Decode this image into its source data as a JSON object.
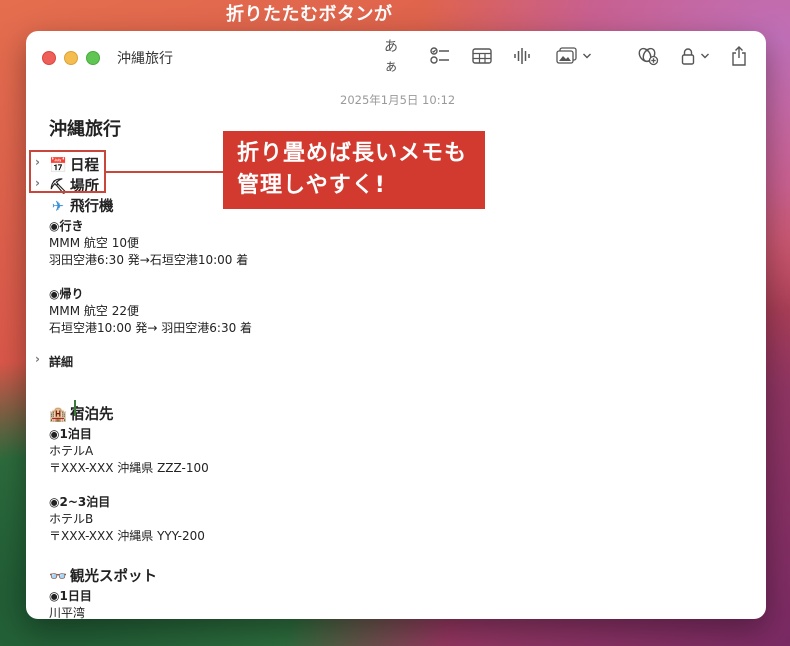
{
  "caption": "折りたたむボタンが",
  "window": {
    "title": "沖縄旅行",
    "toolbar": {
      "format_label": "あぁ"
    }
  },
  "note": {
    "date": "2025年1月5日 10:12",
    "title": "沖縄旅行",
    "lines": {
      "schedule": "日程",
      "place": "場所",
      "flight": "飛行機",
      "outbound_head": "◉行き",
      "outbound_flight": "MMM 航空 10便",
      "outbound_route": "羽田空港6:30 発→石垣空港10:00 着",
      "return_head": "◉帰り",
      "return_flight": "MMM 航空 22便",
      "return_route": "石垣空港10:00 発→ 羽田空港6:30 着",
      "details": "詳細",
      "lodging": "宿泊先",
      "night1_head": "◉1泊目",
      "hotel_a": "ホテルA",
      "hotel_a_addr": "〒XXX-XXX 沖縄県 ZZZ-100",
      "night23_head": "◉2~3泊目",
      "hotel_b": "ホテルB",
      "hotel_b_addr": "〒XXX-XXX 沖縄県 YYY-200",
      "sightseeing": "観光スポット",
      "day1_head": "◉1日目",
      "day1_spot": "川平湾"
    },
    "emoji": {
      "schedule": "📅",
      "place": "⛏",
      "flight": "✈",
      "lodging": "🏨",
      "sightseeing": "👓"
    }
  },
  "callout": {
    "line1": "折り畳めば長いメモも",
    "line2": "管理しやすく!"
  },
  "colors": {
    "accent_red": "#d23a2f"
  }
}
